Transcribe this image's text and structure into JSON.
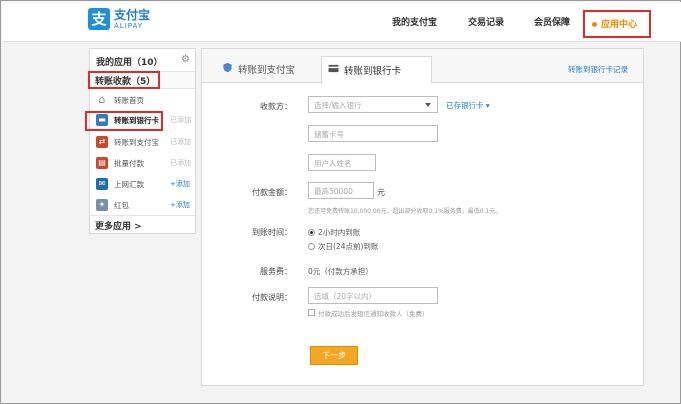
{
  "logo": {
    "cn": "支付宝",
    "en": "ALIPAY",
    "mark": "支"
  },
  "topnav": {
    "items": [
      "我的支付宝",
      "交易记录",
      "会员保障"
    ],
    "active": "应用中心"
  },
  "sidebar": {
    "title": "我的应用（10）",
    "category": "转账收款（5）",
    "items": [
      {
        "label": "转账首页",
        "add": "",
        "icon": "home-icon",
        "color": "#8a8a8a"
      },
      {
        "label": "转账到银行卡",
        "add": "已添加",
        "icon": "bank-card-icon",
        "color": "#3a78c2"
      },
      {
        "label": "转账到支付宝",
        "add": "已添加",
        "icon": "transfer-icon",
        "color": "#c94a2b"
      },
      {
        "label": "批量付款",
        "add": "已添加",
        "icon": "batch-pay-icon",
        "color": "#c94a2b"
      },
      {
        "label": "上网汇款",
        "add": "+添加",
        "icon": "remit-icon",
        "color": "#1f6fa8"
      },
      {
        "label": "红包",
        "add": "+添加",
        "icon": "red-packet-icon",
        "color": "#7a8fa8"
      }
    ],
    "more": "更多应用 >"
  },
  "tabs": {
    "tab1": "转账到支付宝",
    "tab2": "转账到银行卡",
    "link": "转账到银行卡记录"
  },
  "form": {
    "payee_label": "收款方：",
    "bank_placeholder": "选择/输入银行",
    "bank_link": "已存银行卡 ▾",
    "card_placeholder": "储蓄卡号",
    "name_placeholder": "用户人姓名",
    "amount_label": "付款金额：",
    "amount_placeholder": "最高50000",
    "amount_unit": "元",
    "amount_hint": "您还可免费转账10,000.00元，超出部分收取0.1%服务费，最低0.1元。",
    "arrival_label": "到账时间：",
    "arrival_opt1": "2小时内到账",
    "arrival_opt2": "次日(24点前)到账",
    "fee_label": "服务费：",
    "fee_value": "0元（付款方承担）",
    "memo_label": "付款说明：",
    "memo_placeholder": "选填（20字以内）",
    "memo_check": "付款成功后发短信通知收款人（免费）",
    "next": "下一步"
  },
  "colors": {
    "accent": "#f5a623",
    "link": "#1e7fc9",
    "highlight": "#e02b2b"
  }
}
